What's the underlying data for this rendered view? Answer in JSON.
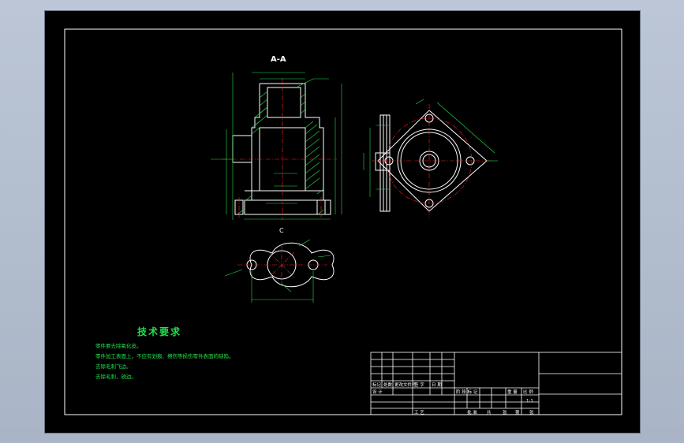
{
  "section_label": "A-A",
  "view_c_label": "C",
  "tech_title": "技术要求",
  "requirements": [
    "零件要去除氧化皮。",
    "零件加工表面上，不应有划痕、擦伤等损伤零件表面的缺陷。",
    "去除毛刺飞边。",
    "去除毛刺，锐边。"
  ],
  "title_block": {
    "row_labels": [
      "标记",
      "处数",
      "更改文件号",
      "签 字",
      "日 期"
    ],
    "design": "设 计",
    "stage": "阶 段 标 记",
    "weight": "重 量",
    "scale_label": "比 例",
    "scale": "1:1",
    "process": "工 艺",
    "approve": "批 准",
    "share": "共",
    "sheet": "张",
    "page": "第",
    "page_sheet": "张"
  },
  "colors": {
    "background": "#000000",
    "frame": "#ffffff",
    "geometry": "#ffffff",
    "dimension": "#22e04a",
    "centerline": "#ff2020",
    "hatch": "#22e04a"
  }
}
